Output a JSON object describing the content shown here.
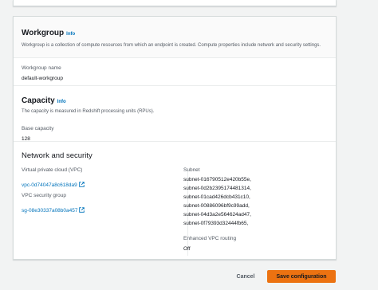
{
  "workgroup": {
    "title": "Workgroup",
    "info": "Info",
    "description": "Workgroup is a collection of compute resources from which an endpoint is created. Compute properties include network and security settings.",
    "name_label": "Workgroup name",
    "name_value": "default-workgroup"
  },
  "capacity": {
    "title": "Capacity",
    "info": "Info",
    "description": "The capacity is measured in Redshift processing units (RPUs).",
    "base_label": "Base capacity",
    "base_value": "128"
  },
  "network": {
    "title": "Network and security",
    "vpc_label": "Virtual private cloud (VPC)",
    "vpc_value": "vpc-0d74047a8c618da9",
    "sg_label": "VPC security group",
    "sg_value": "sg-08e30337a08b0a457",
    "subnet_label": "Subnet",
    "subnets": [
      "subnet-016790512e420b55e,",
      "subnet-0d2b2395174481314,",
      "subnet-01cad426dcb431c10,",
      "subnet-00886096bf9c99add,",
      "subnet-04d3a2e564624ad47,",
      "subnet-0f79393d32444fb65,"
    ],
    "enhanced_label": "Enhanced VPC routing",
    "enhanced_value": "Off"
  },
  "actions": {
    "cancel": "Cancel",
    "save": "Save configuration"
  },
  "colors": {
    "link": "#0073bb",
    "primary_button": "#ec7211"
  },
  "icons": {
    "external_link": "external-link-icon"
  }
}
